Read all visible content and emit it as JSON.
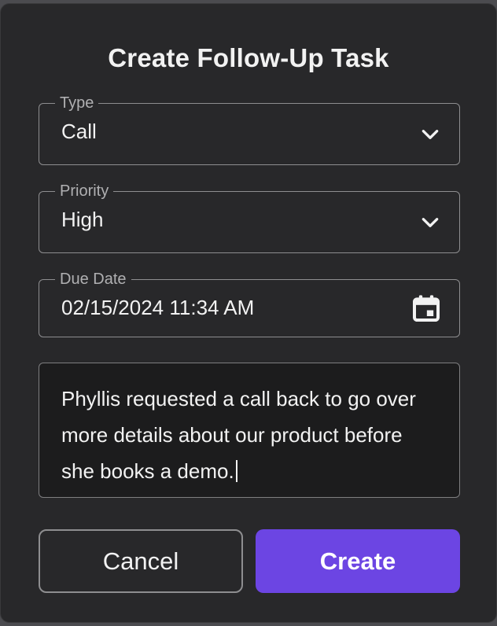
{
  "dialog": {
    "title": "Create Follow-Up Task",
    "type_field": {
      "label": "Type",
      "value": "Call",
      "icon": "chevron-down-icon"
    },
    "priority_field": {
      "label": "Priority",
      "value": "High",
      "icon": "chevron-down-icon"
    },
    "due_date_field": {
      "label": "Due Date",
      "value": "02/15/2024 11:34 AM",
      "icon": "calendar-icon"
    },
    "notes": {
      "value": "Phyllis requested a call back to go over more details about our product before she books a demo."
    },
    "buttons": {
      "cancel": "Cancel",
      "create": "Create"
    },
    "colors": {
      "dialog_bg": "#28282a",
      "primary": "#6c45e3",
      "border": "#8e8e90",
      "text": "#f2f2f2"
    }
  }
}
